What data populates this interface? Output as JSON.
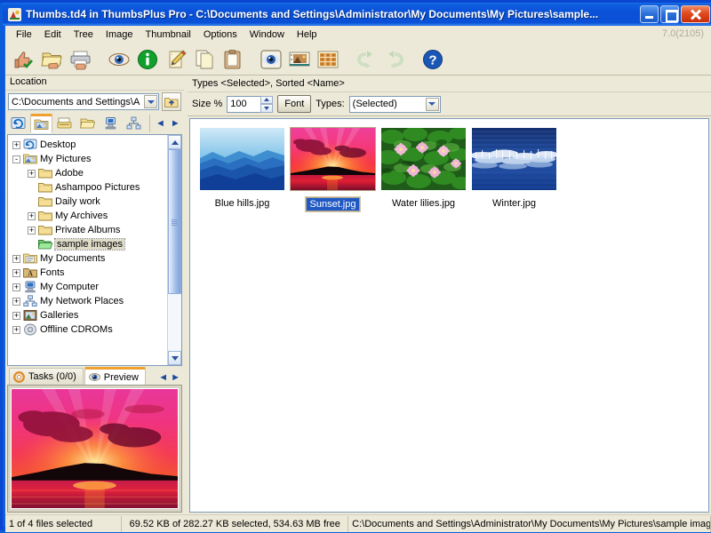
{
  "window": {
    "title": "Thumbs.td4 in ThumbsPlus Pro - C:\\Documents and Settings\\Administrator\\My Documents\\My Pictures\\sample...",
    "app_icon": "thumbsplus-icon",
    "minimize_label": "Minimize",
    "maximize_label": "Maximize",
    "close_label": "Close",
    "version": "7.0(2105)",
    "accent_title_color": "#0a51d8",
    "face_color": "#ece9d8",
    "selection_color": "#2159c4"
  },
  "menubar": {
    "items": [
      {
        "label": "File",
        "name": "menu-file"
      },
      {
        "label": "Edit",
        "name": "menu-edit"
      },
      {
        "label": "Tree",
        "name": "menu-tree"
      },
      {
        "label": "Image",
        "name": "menu-image"
      },
      {
        "label": "Thumbnail",
        "name": "menu-thumbnail"
      },
      {
        "label": "Options",
        "name": "menu-options"
      },
      {
        "label": "Window",
        "name": "menu-window"
      },
      {
        "label": "Help",
        "name": "menu-help"
      }
    ]
  },
  "toolbar": {
    "buttons": [
      {
        "name": "thumbnail-ok-button",
        "icon": "thumb-up-icon",
        "title": "Thumbnail"
      },
      {
        "name": "batch-folder-button",
        "icon": "folder-hand-icon",
        "title": "Batch Folder"
      },
      {
        "name": "print-button",
        "icon": "printer-hand-icon",
        "title": "Print"
      },
      {
        "name": "view-image-button",
        "icon": "eye-icon",
        "title": "View Image"
      },
      {
        "name": "image-info-button",
        "icon": "info-icon",
        "title": "Image Info"
      },
      {
        "name": "edit-image-button",
        "icon": "pencil-page-icon",
        "title": "Edit"
      },
      {
        "name": "copy-button",
        "icon": "copy-pages-icon",
        "title": "Copy"
      },
      {
        "name": "paste-button",
        "icon": "clipboard-icon",
        "title": "Paste"
      },
      {
        "name": "slideshow-button",
        "icon": "blue-eye-icon",
        "title": "Slide Show"
      },
      {
        "name": "filmstrip-button",
        "icon": "filmstrip-icon",
        "title": "Filmstrip View"
      },
      {
        "name": "contact-sheet-button",
        "icon": "contact-sheet-icon",
        "title": "Contact Sheet"
      },
      {
        "name": "back-button",
        "icon": "arrow-back-icon",
        "title": "Back"
      },
      {
        "name": "forward-button",
        "icon": "arrow-forward-icon",
        "title": "Forward"
      },
      {
        "name": "help-button",
        "icon": "question-mark-icon",
        "title": "Help"
      }
    ]
  },
  "left_pane": {
    "header": "Location",
    "location": {
      "value": "C:\\Documents and Settings\\A",
      "placeholder": "Location",
      "up_button": "up-folder-icon"
    },
    "tree_toolbar": [
      {
        "name": "tree-btn-desktop",
        "icon": "desktop-refresh-icon"
      },
      {
        "name": "tree-btn-pictures",
        "icon": "my-pictures-icon",
        "active": true
      },
      {
        "name": "tree-btn-scanner",
        "icon": "scanner-icon"
      },
      {
        "name": "tree-btn-folder",
        "icon": "open-folder-icon"
      },
      {
        "name": "tree-btn-drive",
        "icon": "network-drive-icon"
      },
      {
        "name": "tree-btn-network",
        "icon": "network-icon"
      }
    ],
    "tree_nav": {
      "prev": "◄",
      "next": "►"
    },
    "tree": [
      {
        "label": "Desktop",
        "indent": 0,
        "expander": "+",
        "icon": "desktop-icon",
        "selected": false
      },
      {
        "label": "My Pictures",
        "indent": 0,
        "expander": "-",
        "icon": "my-pictures-icon",
        "selected": false
      },
      {
        "label": "Adobe",
        "indent": 1,
        "expander": "+",
        "icon": "folder-icon",
        "selected": false
      },
      {
        "label": "Ashampoo Pictures",
        "indent": 1,
        "expander": "",
        "icon": "folder-icon",
        "selected": false
      },
      {
        "label": "Daily work",
        "indent": 1,
        "expander": "",
        "icon": "folder-icon",
        "selected": false
      },
      {
        "label": "My Archives",
        "indent": 1,
        "expander": "+",
        "icon": "folder-icon",
        "selected": false
      },
      {
        "label": "Private Albums",
        "indent": 1,
        "expander": "+",
        "icon": "folder-icon",
        "selected": false
      },
      {
        "label": "sample images",
        "indent": 1,
        "expander": "",
        "icon": "folder-open-green-icon",
        "selected": true
      },
      {
        "label": "My Documents",
        "indent": 0,
        "expander": "+",
        "icon": "my-documents-icon",
        "selected": false
      },
      {
        "label": "Fonts",
        "indent": 0,
        "expander": "+",
        "icon": "fonts-folder-icon",
        "selected": false
      },
      {
        "label": "My Computer",
        "indent": 0,
        "expander": "+",
        "icon": "my-computer-icon",
        "selected": false
      },
      {
        "label": "My Network Places",
        "indent": 0,
        "expander": "+",
        "icon": "network-icon",
        "selected": false
      },
      {
        "label": "Galleries",
        "indent": 0,
        "expander": "+",
        "icon": "galleries-icon",
        "selected": false
      },
      {
        "label": "Offline CDROMs",
        "indent": 0,
        "expander": "+",
        "icon": "cdrom-icon",
        "selected": false
      }
    ],
    "bottom_tabs": [
      {
        "label": "Tasks (0/0)",
        "name": "tab-tasks",
        "icon": "gear-icon",
        "active": false
      },
      {
        "label": "Preview",
        "name": "tab-preview",
        "icon": "eye-icon",
        "active": true
      }
    ],
    "tab_nav": {
      "prev": "◄",
      "next": "►"
    },
    "preview": {
      "name": "preview-image",
      "alt": "Sunset.jpg"
    }
  },
  "right_pane": {
    "types_sorted_label": "Types <Selected>, Sorted <Name>",
    "size_label": "Size %",
    "size_value": "100",
    "font_button": "Font",
    "types_label": "Types:",
    "types_value": "(Selected)",
    "thumbnails": [
      {
        "filename": "Blue hills.jpg",
        "art": "blue-hills",
        "selected": false
      },
      {
        "filename": "Sunset.jpg",
        "art": "sunset",
        "selected": true
      },
      {
        "filename": "Water lilies.jpg",
        "art": "water-lilies",
        "selected": false
      },
      {
        "filename": "Winter.jpg",
        "art": "winter",
        "selected": false
      }
    ]
  },
  "statusbar": {
    "files_selected": "1 of 4 files selected",
    "size_info": "69.52 KB of 282.27 KB selected, 534.63 MB free",
    "path": "C:\\Documents and Settings\\Administrator\\My Documents\\My Pictures\\sample imag"
  }
}
